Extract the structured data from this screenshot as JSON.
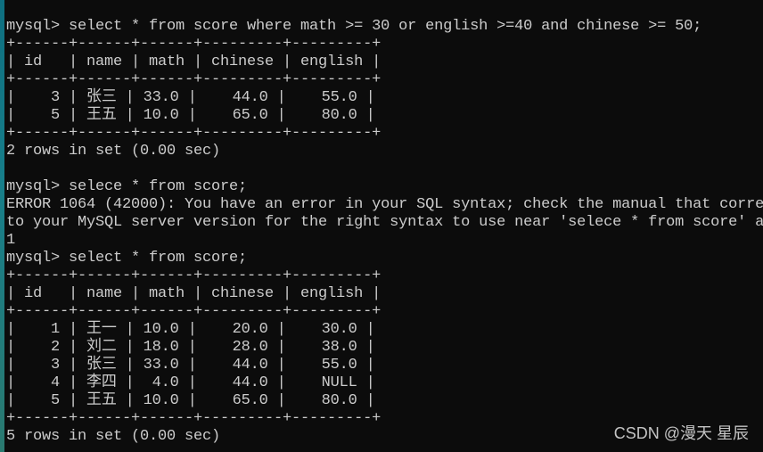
{
  "window": {
    "type": "terminal",
    "app": "mysql client"
  },
  "console": {
    "prompt": "mysql> ",
    "blocks": [
      {
        "command": "select * from score where math >= 30 or english >=40 and chinese >= 50;",
        "table": {
          "columns": [
            "id",
            "name",
            "math",
            "chinese",
            "english"
          ],
          "rows": [
            [
              "3",
              "张三",
              "33.0",
              "44.0",
              "55.0"
            ],
            [
              "5",
              "王五",
              "10.0",
              "65.0",
              "80.0"
            ]
          ]
        },
        "result": "2 rows in set (0.00 sec)"
      },
      {
        "command": "selece * from score;",
        "error": [
          "ERROR 1064 (42000): You have an error in your SQL syntax; check the manual that corre",
          "to your MySQL server version for the right syntax to use near 'selece * from score' a",
          "1"
        ]
      },
      {
        "command": "select * from score;",
        "table": {
          "columns": [
            "id",
            "name",
            "math",
            "chinese",
            "english"
          ],
          "rows": [
            [
              "1",
              "王一",
              "10.0",
              "20.0",
              "30.0"
            ],
            [
              "2",
              "刘二",
              "18.0",
              "28.0",
              "38.0"
            ],
            [
              "3",
              "张三",
              "33.0",
              "44.0",
              "55.0"
            ],
            [
              "4",
              "李四",
              "4.0",
              "44.0",
              "NULL"
            ],
            [
              "5",
              "王五",
              "10.0",
              "65.0",
              "80.0"
            ]
          ]
        },
        "result": "5 rows in set (0.00 sec)"
      }
    ]
  },
  "watermark": "CSDN @漫天 星辰",
  "colors": {
    "background": "#0c0c0c",
    "text": "#cccccc",
    "edge": "#177e8a"
  }
}
